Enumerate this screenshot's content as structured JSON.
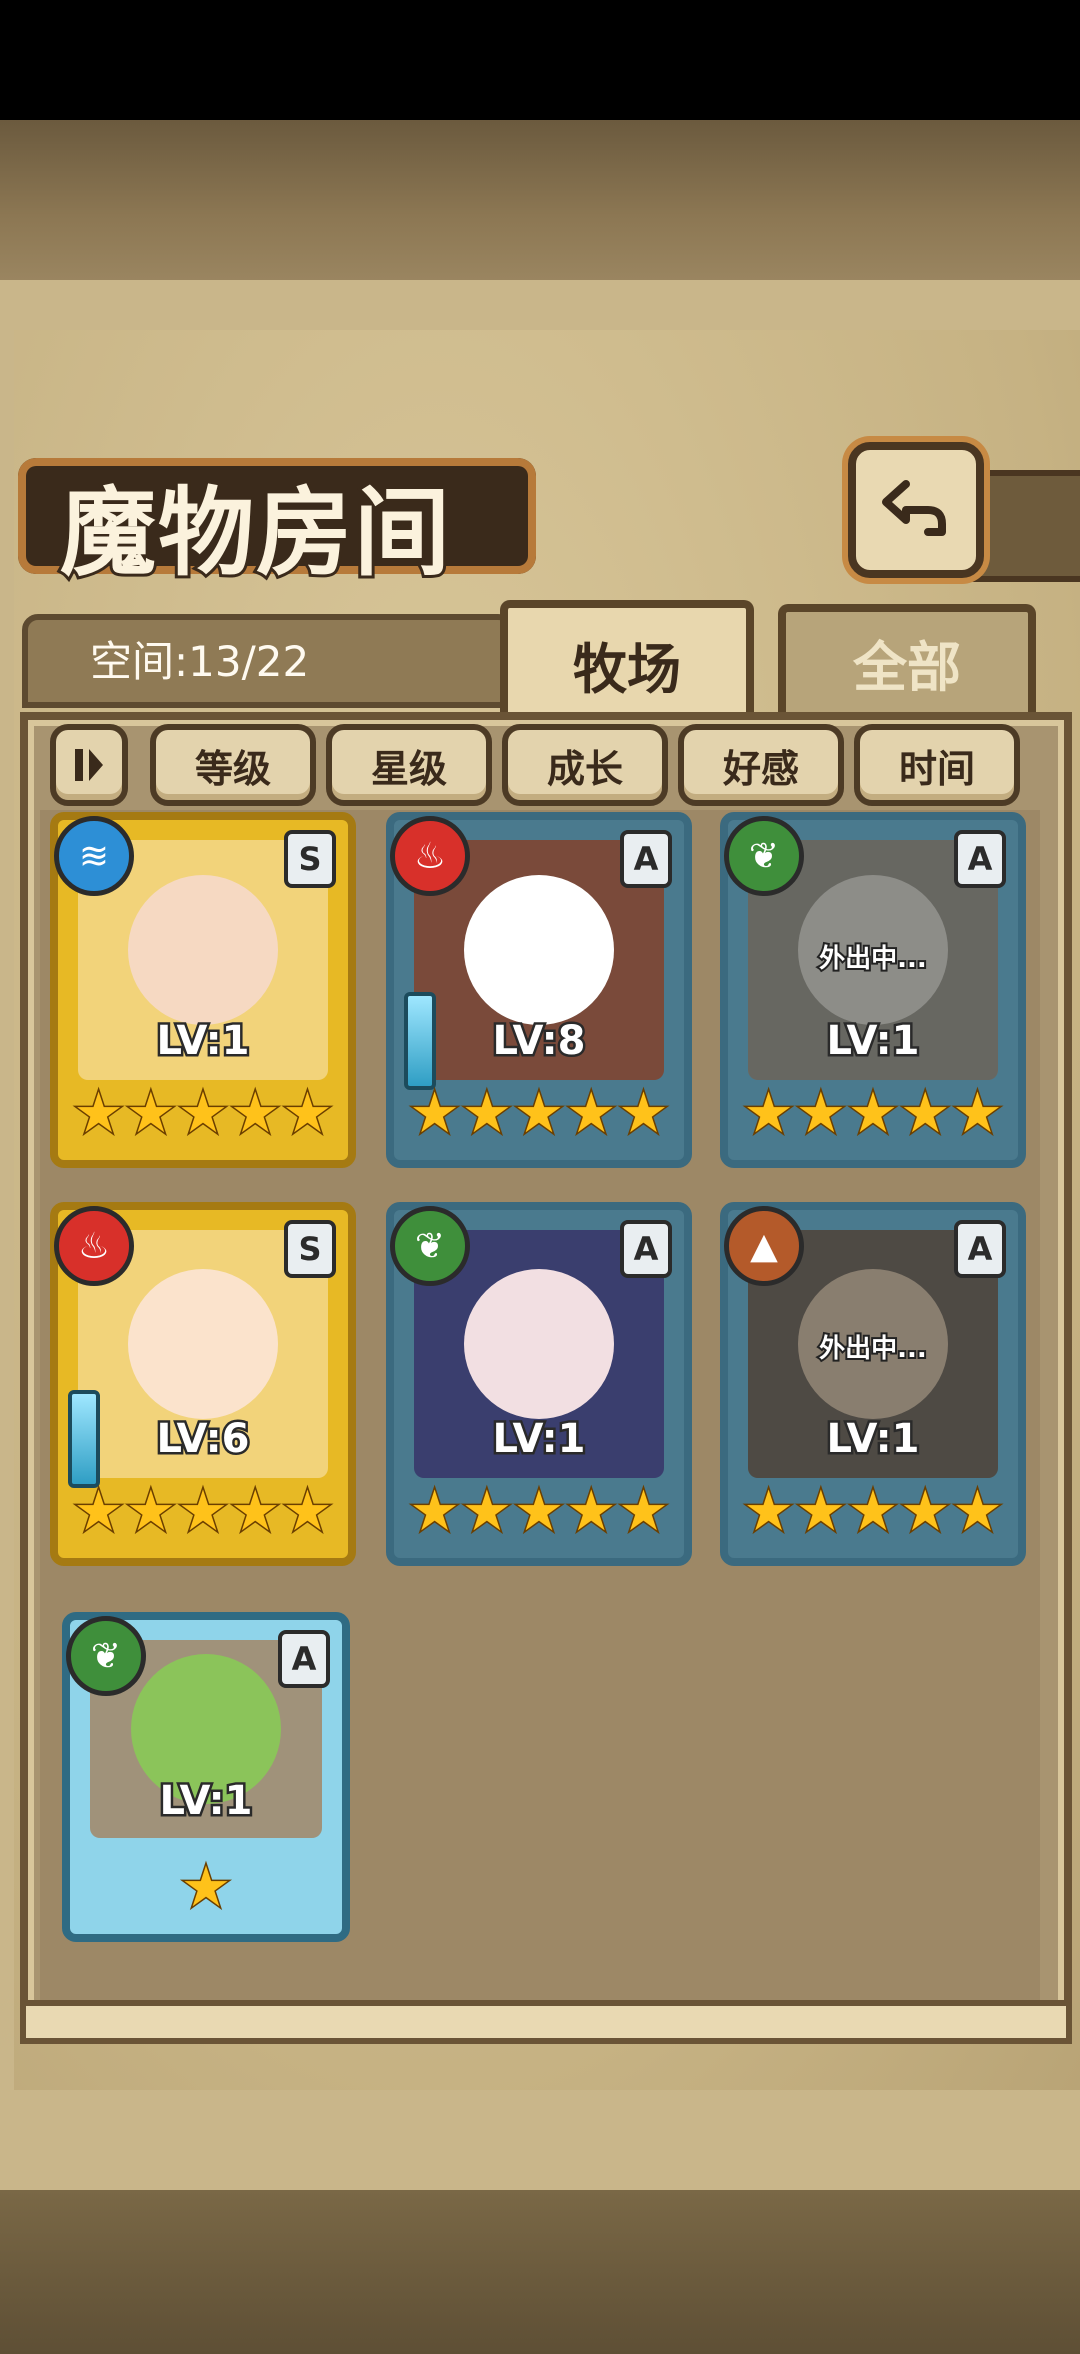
{
  "title": "魔物房间",
  "space": "空间:13/22",
  "tabs": {
    "ranch": "牧场",
    "all": "全部"
  },
  "sort": [
    "等级",
    "星级",
    "成长",
    "好感",
    "时间"
  ],
  "cards": [
    {
      "level": "LV:1",
      "rank": "S",
      "element": "water",
      "frame": "gold",
      "stars": 5,
      "away": ""
    },
    {
      "level": "LV:8",
      "rank": "A",
      "element": "fire",
      "frame": "blue",
      "stars": 5,
      "away": ""
    },
    {
      "level": "LV:1",
      "rank": "A",
      "element": "leaf",
      "frame": "blue",
      "stars": 5,
      "away": "外出中..."
    },
    {
      "level": "LV:6",
      "rank": "S",
      "element": "fire",
      "frame": "gold",
      "stars": 5,
      "away": ""
    },
    {
      "level": "LV:1",
      "rank": "A",
      "element": "leaf",
      "frame": "blue",
      "stars": 5,
      "away": ""
    },
    {
      "level": "LV:1",
      "rank": "A",
      "element": "earth",
      "frame": "blue",
      "stars": 5,
      "away": "外出中..."
    },
    {
      "level": "LV:1",
      "rank": "A",
      "element": "leaf",
      "frame": "blue",
      "stars": 1,
      "away": ""
    }
  ],
  "colors": {
    "water": "#2d8fd6",
    "fire": "#d8302a",
    "leaf": "#3f8f3b",
    "earth": "#b45a2a"
  }
}
